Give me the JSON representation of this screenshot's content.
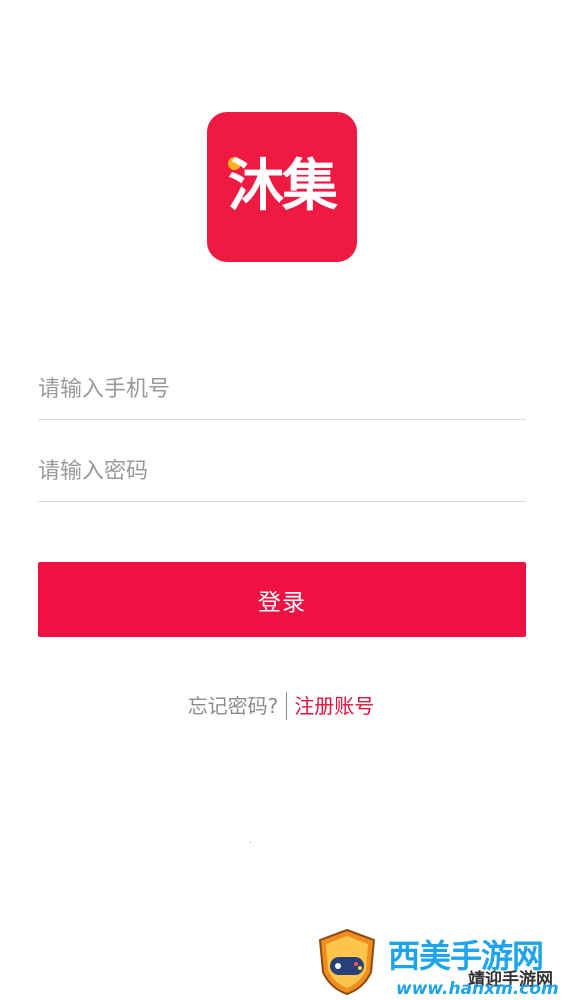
{
  "app": {
    "logo_text": "沐集"
  },
  "login_form": {
    "phone_placeholder": "请输入手机号",
    "password_placeholder": "请输入密码",
    "login_label": "登录"
  },
  "links": {
    "forgot_password": "忘记密码?",
    "register": "注册账号"
  },
  "watermark": {
    "site_name": "西美手游网",
    "overlay_text": "靖迎手游网",
    "url": "www.hanxm.com"
  },
  "colors": {
    "brand_red": "#ef1a41",
    "logo_dot": "#ffb01f",
    "watermark_blue": "#1da4ea"
  }
}
